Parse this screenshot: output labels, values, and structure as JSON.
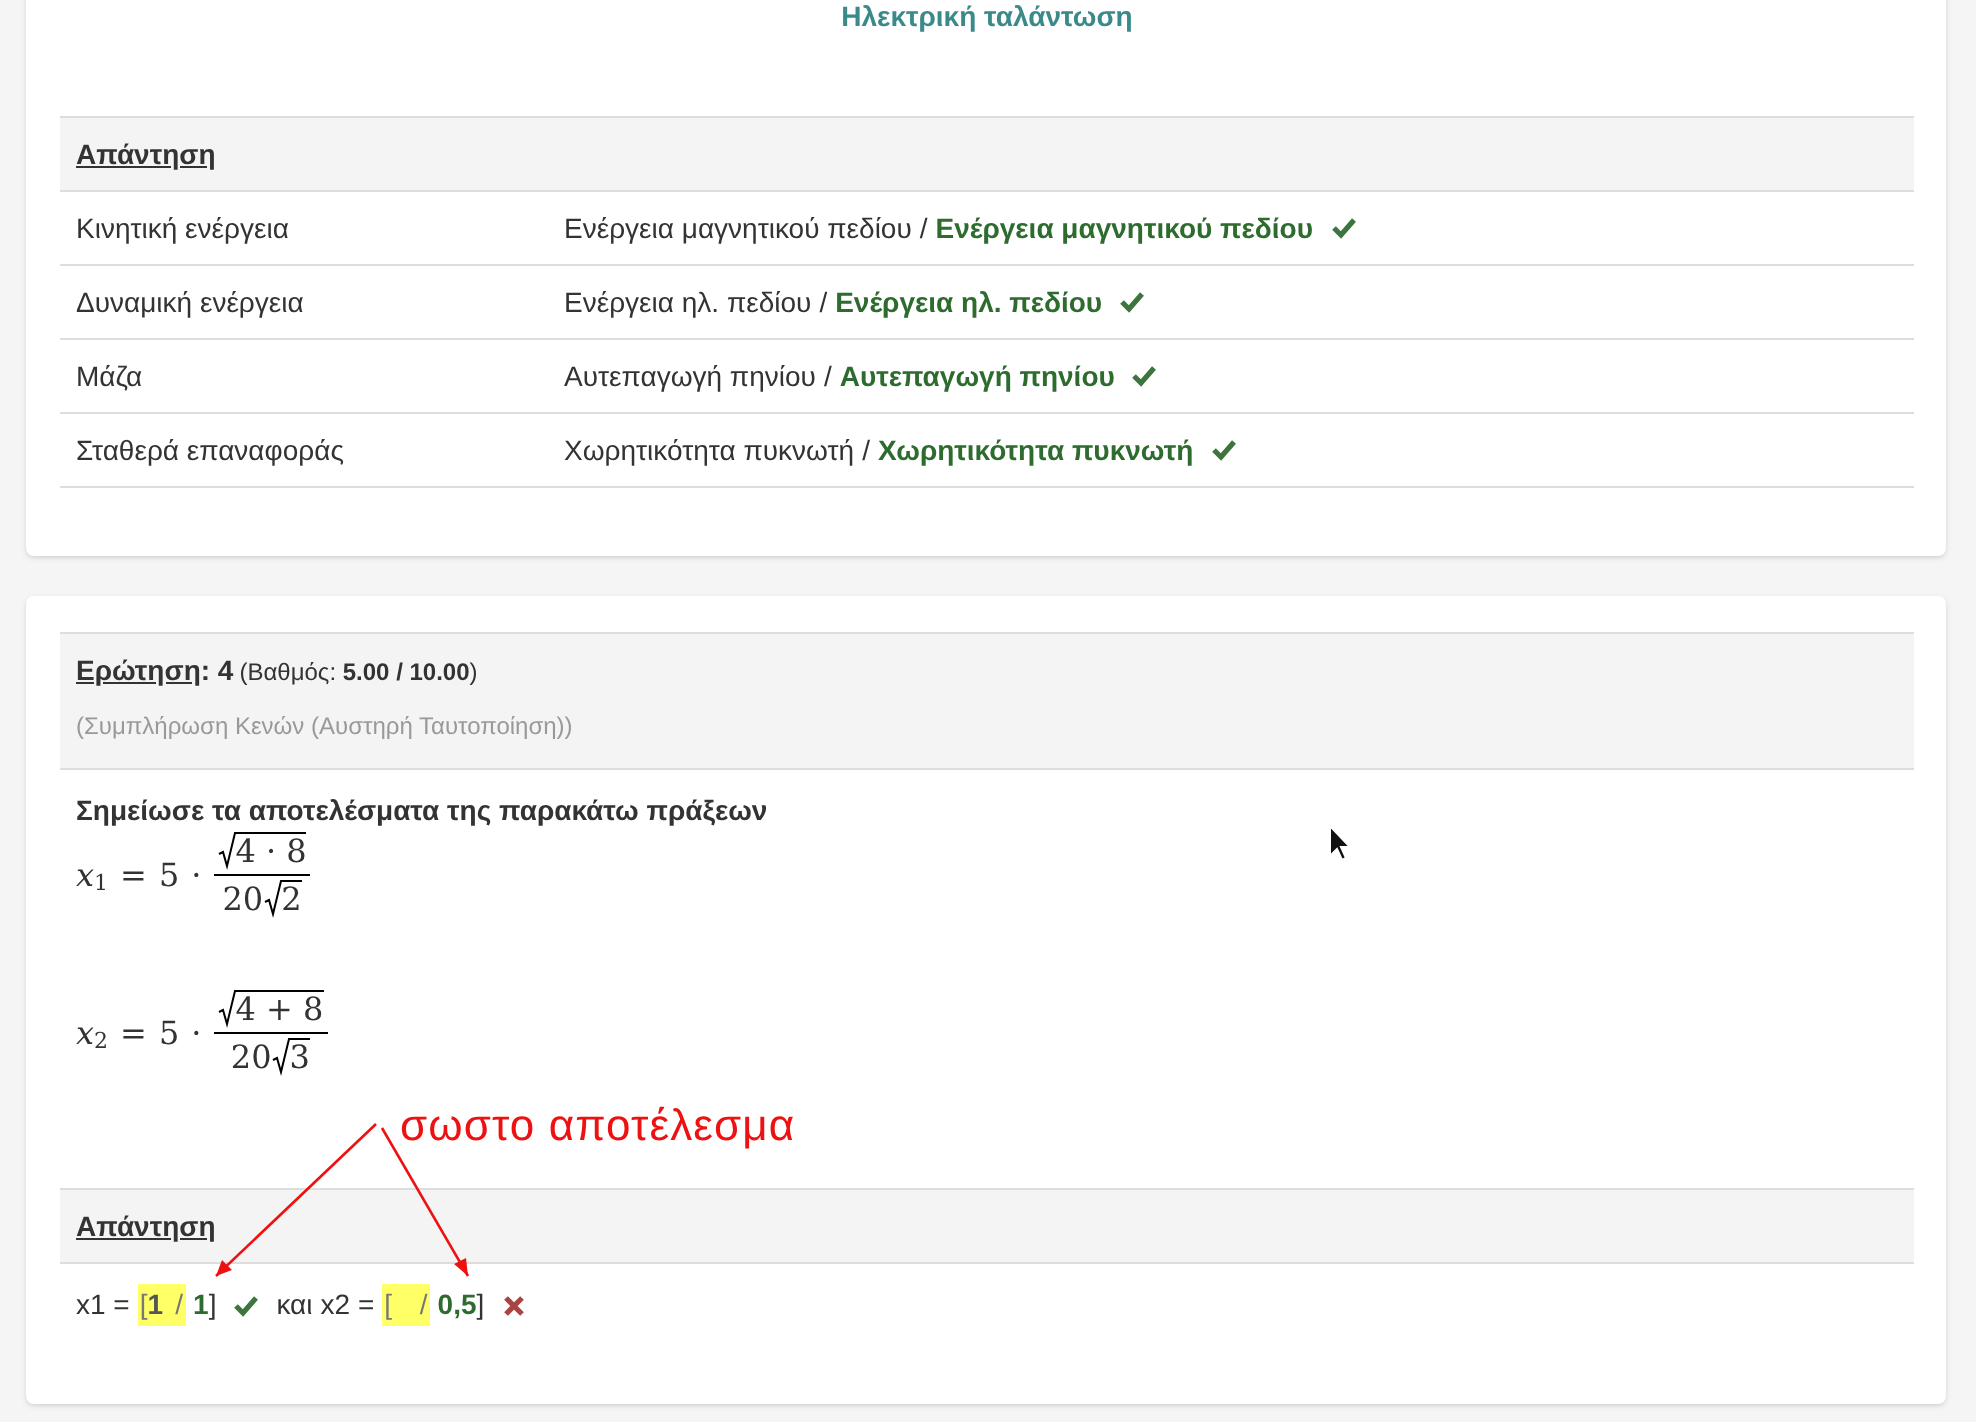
{
  "matching_card": {
    "title": "Ηλεκτρική ταλάντωση",
    "answer_heading": "Απάντηση",
    "rows": [
      {
        "term": "Κινητική ενέργεια",
        "given": "Ενέργεια μαγνητικού πεδίου",
        "separator": "/",
        "correct_answer": "Ενέργεια μαγνητικού πεδίου",
        "correct": true
      },
      {
        "term": "Δυναμική ενέργεια",
        "given": "Ενέργεια ηλ. πεδίου",
        "separator": "/",
        "correct_answer": "Ενέργεια ηλ. πεδίου",
        "correct": true
      },
      {
        "term": "Μάζα",
        "given": "Αυτεπαγωγή πηνίου",
        "separator": "/",
        "correct_answer": "Αυτεπαγωγή πηνίου",
        "correct": true
      },
      {
        "term": "Σταθερά επαναφοράς",
        "given": "Χωρητικότητα πυκνωτή",
        "separator": "/",
        "correct_answer": "Χωρητικότητα πυκνωτή",
        "correct": true
      }
    ]
  },
  "question_card": {
    "question_label": "Ερώτηση",
    "question_number": ": 4",
    "grade_open": "(Βαθμός:",
    "grade_value": "5.00 / 10.00",
    "grade_close": ")",
    "question_type": "(Συμπλήρωση Κενών (Αυστηρή Ταυτοποίηση))",
    "prompt": "Σημείωσε τα αποτελέσματα της παρακάτω πράξεων",
    "formulas": [
      {
        "variable": "x",
        "subscript": "1",
        "equals": "=",
        "coefficient": "5",
        "dot": "·",
        "numerator_root": "4 · 8",
        "denominator_coefficient": "20",
        "denominator_root": "2"
      },
      {
        "variable": "x",
        "subscript": "2",
        "equals": "=",
        "coefficient": "5",
        "dot": "·",
        "numerator_root": "4 + 8",
        "denominator_coefficient": "20",
        "denominator_root": "3"
      }
    ],
    "annotation": "σωστο αποτέλεσμα",
    "answer_heading": "Απάντηση",
    "blanks": [
      {
        "label": "x1 =",
        "open": "[",
        "given": "1",
        "separator": "/",
        "correct_answer": "1",
        "close": "]",
        "correct": true,
        "joiner": "και"
      },
      {
        "label": "x2 =",
        "open": "[",
        "separator": "/",
        "correct_answer": "0,5",
        "close": "]",
        "correct": false
      }
    ]
  }
}
